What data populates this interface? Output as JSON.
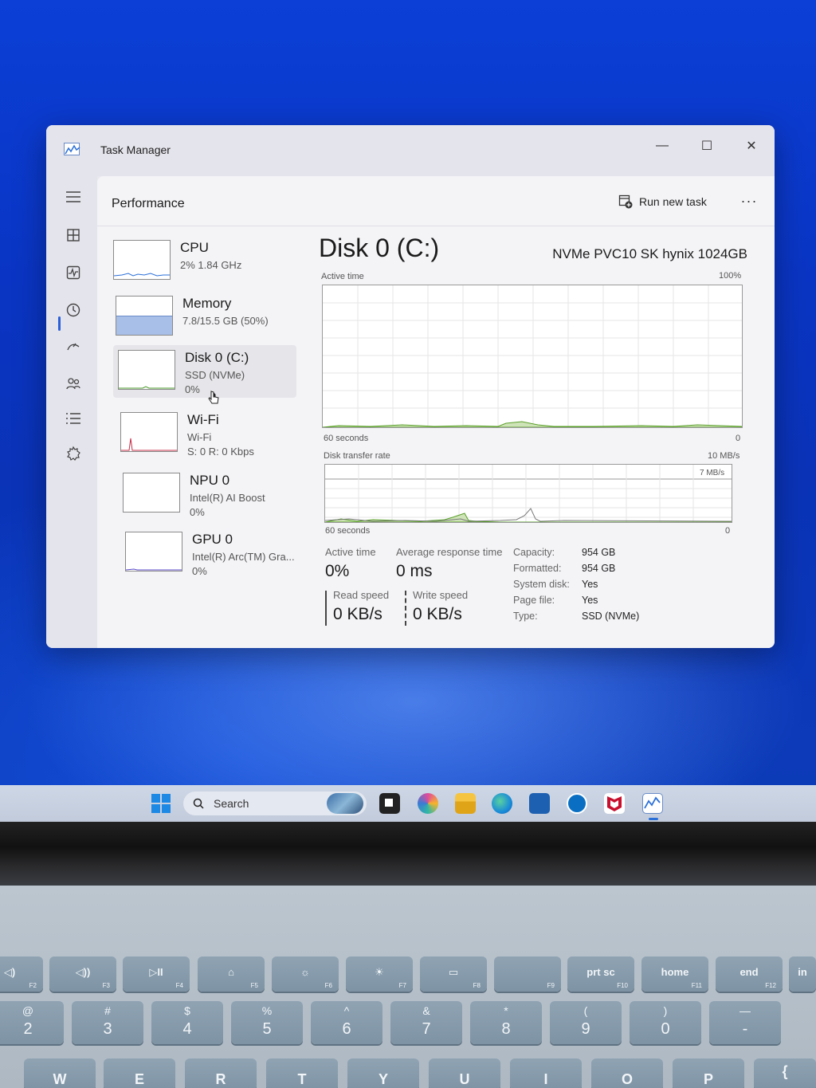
{
  "window": {
    "title": "Task Manager",
    "minimize": "—",
    "maximize": "☐",
    "close": "✕"
  },
  "header": {
    "page_title": "Performance",
    "run_new_task": "Run new task",
    "more": "···"
  },
  "devices": [
    {
      "name": "CPU",
      "sub1": "2%  1.84 GHz",
      "sub2": ""
    },
    {
      "name": "Memory",
      "sub1": "7.8/15.5 GB (50%)",
      "sub2": ""
    },
    {
      "name": "Disk 0 (C:)",
      "sub1": "SSD (NVMe)",
      "sub2": "0%"
    },
    {
      "name": "Wi-Fi",
      "sub1": "Wi-Fi",
      "sub2": "S: 0  R: 0 Kbps"
    },
    {
      "name": "NPU 0",
      "sub1": "Intel(R) AI Boost",
      "sub2": "0%"
    },
    {
      "name": "GPU 0",
      "sub1": "Intel(R) Arc(TM) Gra...",
      "sub2": "0%"
    }
  ],
  "detail": {
    "title": "Disk 0 (C:)",
    "model": "NVMe PVC10 SK hynix 1024GB",
    "chart1": {
      "label": "Active time",
      "max": "100%",
      "xlabel": "60 seconds",
      "min": "0"
    },
    "chart2": {
      "label": "Disk transfer rate",
      "max": "10 MB/s",
      "inner_max": "7 MB/s",
      "xlabel": "60 seconds",
      "min": "0"
    },
    "stats": {
      "active_time_label": "Active time",
      "active_time_value": "0%",
      "response_label": "Average response time",
      "response_value": "0 ms",
      "read_label": "Read speed",
      "read_value": "0 KB/s",
      "write_label": "Write speed",
      "write_value": "0 KB/s"
    },
    "props": [
      {
        "label": "Capacity:",
        "value": "954 GB"
      },
      {
        "label": "Formatted:",
        "value": "954 GB"
      },
      {
        "label": "System disk:",
        "value": "Yes"
      },
      {
        "label": "Page file:",
        "value": "Yes"
      },
      {
        "label": "Type:",
        "value": "SSD (NVMe)"
      }
    ]
  },
  "taskbar": {
    "search_placeholder": "Search"
  },
  "keyboard": {
    "fn_row": [
      {
        "main": "◁)",
        "fn": "F2"
      },
      {
        "main": "◁))",
        "fn": "F3"
      },
      {
        "main": "▷II",
        "fn": "F4"
      },
      {
        "main": "⌂",
        "fn": "F5"
      },
      {
        "main": "☼",
        "fn": "F6"
      },
      {
        "main": "☀",
        "fn": "F7"
      },
      {
        "main": "▭",
        "fn": "F8"
      },
      {
        "main": "",
        "fn": "F9"
      },
      {
        "main": "prt sc",
        "fn": "F10"
      },
      {
        "main": "home",
        "fn": "F11"
      },
      {
        "main": "end",
        "fn": "F12"
      },
      {
        "main": "in",
        "fn": ""
      }
    ],
    "num_row": [
      {
        "top": "@",
        "bot": "2"
      },
      {
        "top": "#",
        "bot": "3"
      },
      {
        "top": "$",
        "bot": "4"
      },
      {
        "top": "%",
        "bot": "5"
      },
      {
        "top": "^",
        "bot": "6"
      },
      {
        "top": "&",
        "bot": "7"
      },
      {
        "top": "*",
        "bot": "8"
      },
      {
        "top": "(",
        "bot": "9"
      },
      {
        "top": ")",
        "bot": "0"
      },
      {
        "top": "—",
        "bot": "-"
      }
    ],
    "letter_row": [
      "W",
      "E",
      "R",
      "T",
      "Y",
      "U",
      "I",
      "O",
      "P",
      "{"
    ]
  }
}
